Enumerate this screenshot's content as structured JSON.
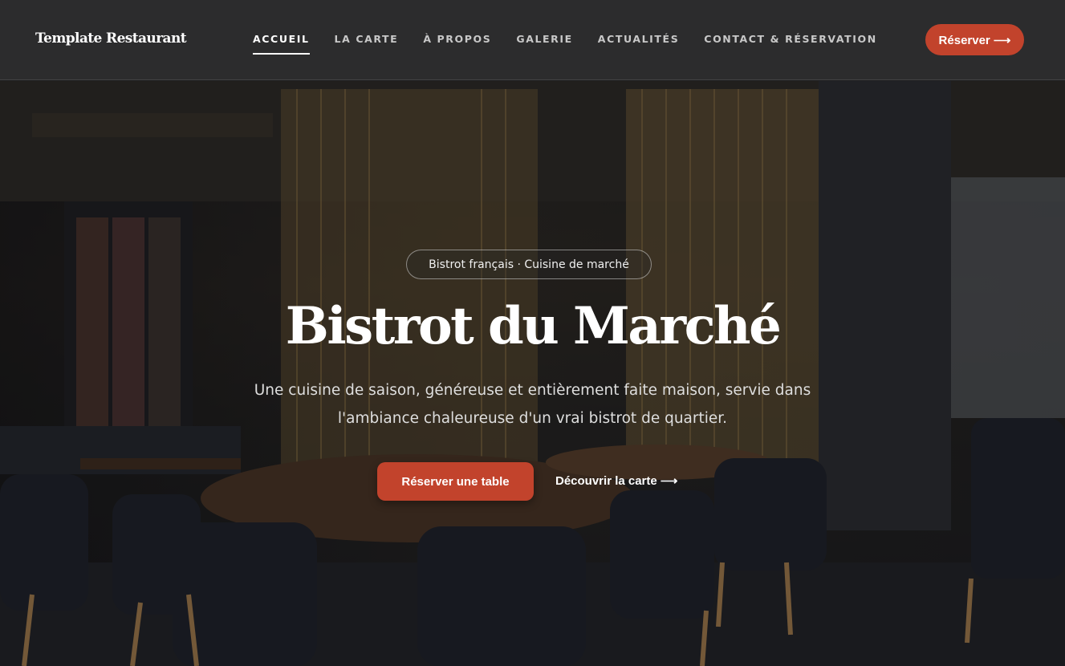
{
  "header": {
    "brand": "Template Restaurant",
    "nav": [
      {
        "label": "ACCUEIL",
        "active": true
      },
      {
        "label": "LA CARTE",
        "active": false
      },
      {
        "label": "À PROPOS",
        "active": false
      },
      {
        "label": "GALERIE",
        "active": false
      },
      {
        "label": "ACTUALITÉS",
        "active": false
      },
      {
        "label": "CONTACT & RÉSERVATION",
        "active": false
      }
    ],
    "cta_label": "Réserver ⟶"
  },
  "hero": {
    "tag": "Bistrot français · Cuisine de marché",
    "title": "Bistrot du Marché",
    "subtitle": "Une cuisine de saison, généreuse et entièrement faite maison, servie dans l'ambiance chaleureuse d'un vrai bistrot de quartier.",
    "primary_button": "Réserver une table",
    "secondary_link": "Découvrir la carte ⟶",
    "background_image": "restaurant-interior"
  },
  "colors": {
    "accent": "#c2432c",
    "header_bg": "#2c2c2d"
  }
}
